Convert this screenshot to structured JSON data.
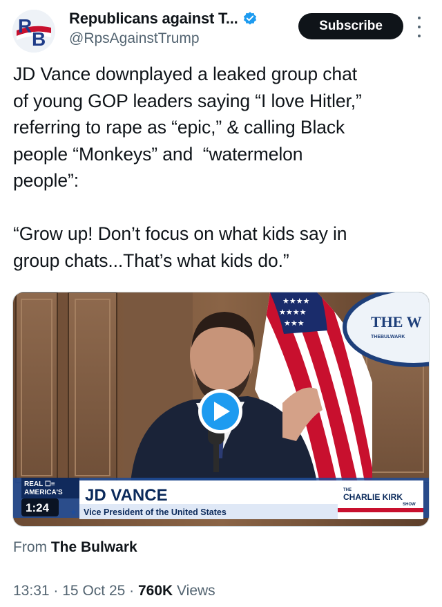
{
  "account": {
    "display_name": "Republicans against T...",
    "handle": "@RpsAgainstTrump",
    "verified": true,
    "avatar_letters": "RB",
    "avatar_icon": "republicans-against-trump-logo"
  },
  "actions": {
    "subscribe_label": "Subscribe",
    "more_icon": "more-options-icon"
  },
  "tweet": {
    "text": "JD Vance downplayed a leaked group chat\nof young GOP leaders saying “I love Hitler,”\nreferring to rape as “epic,” & calling Black\npeople “Monkeys” and  “watermelon\npeople”:\n\n“Grow up! Don’t focus on what kids say in\ngroup chats...That’s what kids do.”"
  },
  "video": {
    "duration": "1:24",
    "play_icon": "play-icon",
    "lower_third_name": "JD VANCE",
    "lower_third_title": "Vice President of the United States",
    "network_logo": "REAL AMERICA'S VOICE",
    "show_logo": "CHARLIE KIRK",
    "show_logo_prefix": "THE",
    "show_logo_suffix": "SHOW",
    "backdrop_text": "THE W",
    "backdrop_subtext": "THEBULWARK",
    "colors": {
      "play_button": "#1d9bf0",
      "lower_third_bg": "#ffffff",
      "lower_third_text": "#0b2a5b"
    }
  },
  "attribution": {
    "prefix": "From",
    "source": "The Bulwark"
  },
  "meta": {
    "time": "13:31",
    "date": "15 Oct 25",
    "views_count": "760K",
    "views_label": "Views",
    "separator": "·"
  }
}
